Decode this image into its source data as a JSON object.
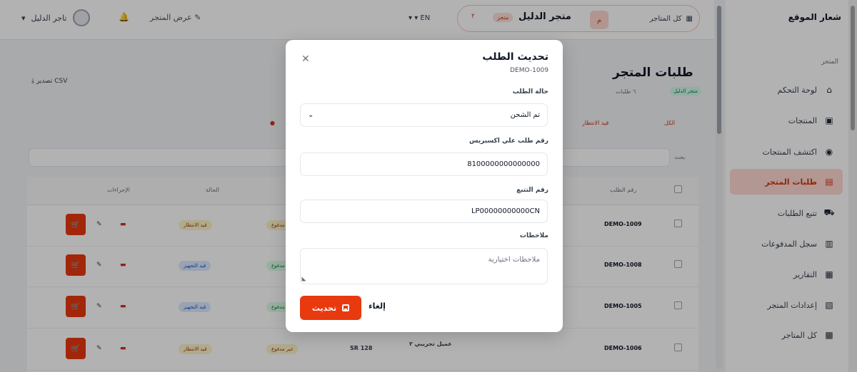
{
  "sidebar": {
    "logo": "شعار الموقع",
    "section": "المتجر",
    "items": [
      {
        "label": "لوحة التحكم",
        "icon": "home-icon",
        "glyph": "⌂"
      },
      {
        "label": "المنتجات",
        "icon": "box-icon",
        "glyph": "▣"
      },
      {
        "label": "اكتشف المنتجات",
        "icon": "compass-icon",
        "glyph": "◉"
      },
      {
        "label": "طلبات المتجر",
        "icon": "receipt-icon",
        "glyph": "▤",
        "active": true
      },
      {
        "label": "تتبع الطلبات",
        "icon": "truck-icon",
        "glyph": "⛟"
      },
      {
        "label": "سجل المدفوعات",
        "icon": "wallet-icon",
        "glyph": "▥"
      },
      {
        "label": "التقارير",
        "icon": "chart-icon",
        "glyph": "▦"
      },
      {
        "label": "إعدادات المتجر",
        "icon": "store-icon",
        "glyph": "▧"
      },
      {
        "label": "كل المتاجر",
        "icon": "grid-icon",
        "glyph": "▩"
      }
    ]
  },
  "topbar": {
    "all_stores": "كل المتاجر",
    "store_name": "متجر الدليل",
    "store_tag": "متجر",
    "store_num": "٢",
    "lang": "EN",
    "view_store": "عرض المتجر",
    "user_name": "تاجر الدليل"
  },
  "background": {
    "title": "طلبات المتجر",
    "tag": "متجر الدليل",
    "count": "٦ طلبات",
    "export": "تصدير CSV",
    "filter_total": "الكل",
    "filter_pending": "قيد الانتظار",
    "search_label": "بحث",
    "headers": {
      "order": "رقم الطلب",
      "status": "الحالة",
      "actions": "الإجراءات"
    },
    "rows": [
      {
        "id": "DEMO-1009",
        "status": "قيد الانتظار",
        "status_color": "yellow",
        "tag": "مدفوع",
        "tag_color": "yellow"
      },
      {
        "id": "DEMO-1008",
        "status": "قيد التجهيز",
        "status_color": "blue",
        "tag": "مدفوع",
        "tag_color": "green"
      },
      {
        "id": "DEMO-1005",
        "status": "قيد التجهيز",
        "status_color": "blue",
        "tag": "مدفوع",
        "tag_color": "green"
      },
      {
        "id": "DEMO-1006",
        "status": "قيد الانتظار",
        "status_color": "yellow",
        "tag": "غير مدفوع",
        "tag_color": "yellow",
        "customer": "عميل تجريبي ٢",
        "amount": "SR 128"
      }
    ]
  },
  "modal": {
    "title": "تحديث الطلب",
    "order_id": "DEMO-1009",
    "status_label": "حالة الطلب",
    "status_value": "تم الشحن",
    "aliexpress_label": "رقم طلب علي اكسبريس",
    "aliexpress_value": "8100000000000000",
    "tracking_label": "رقم التتبع",
    "tracking_value": "LP00000000000CN",
    "notes_label": "ملاحظات",
    "notes_placeholder": "ملاحظات اختيارية",
    "update_button": "تحديث",
    "cancel_button": "إلغاء"
  },
  "colors": {
    "accent": "#e8390f",
    "active_bg": "#ffd9d3",
    "overlay": "rgba(0,0,0,0.30)"
  }
}
